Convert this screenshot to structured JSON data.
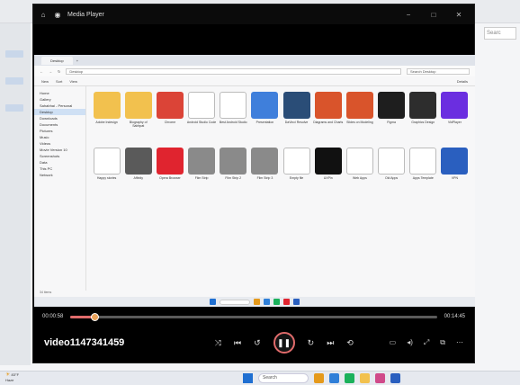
{
  "background_app": {
    "search_label": "Searc"
  },
  "player": {
    "title": "Media Player",
    "window_buttons": [
      "−",
      "□",
      "✕"
    ],
    "current_time": "00:00:58",
    "total_time": "00:14:45",
    "progress_fraction": 0.066,
    "video_name": "video1147341459",
    "accent_color": "#e06b6b"
  },
  "video_frame": {
    "tab_label": "Desktop",
    "address": "Desktop",
    "search_placeholder": "Search Desktop",
    "command_items": [
      "New",
      "Sort",
      "View",
      "Details"
    ],
    "nav_items": [
      "Home",
      "Gallery",
      "Sahabhai - Personal",
      "Desktop",
      "Downloads",
      "Documents",
      "Pictures",
      "Music",
      "Videos",
      "Movie Version 10",
      "Screenshots",
      "Data",
      "This PC",
      "Network"
    ],
    "status_text": "34 items",
    "files": [
      {
        "label": "Adobe Indesign",
        "color": "#f2c14e"
      },
      {
        "label": "Biography of Sabhpat",
        "color": "#f2c14e"
      },
      {
        "label": "Chrome",
        "color": "#db4437"
      },
      {
        "label": "Android Studio Code",
        "color": "#ffffff"
      },
      {
        "label": "Best Android Studio",
        "color": "#ffffff"
      },
      {
        "label": "Presentation",
        "color": "#3f7fdb"
      },
      {
        "label": "DaVinci Resolve",
        "color": "#2a4d77"
      },
      {
        "label": "Diagrams and Charts",
        "color": "#d9542b"
      },
      {
        "label": "Slides on Modeling",
        "color": "#d9542b"
      },
      {
        "label": "Figma",
        "color": "#1e1e1e"
      },
      {
        "label": "Graphics Design",
        "color": "#2d2d2d"
      },
      {
        "label": "VidPlayer",
        "color": "#6b2ee0"
      },
      {
        "label": "Happy stories",
        "color": "#ffffff"
      },
      {
        "label": "Affinity",
        "color": "#5a5a5a"
      },
      {
        "label": "Opera Browser",
        "color": "#e0242f"
      },
      {
        "label": "Film Strip",
        "color": "#8a8a8a"
      },
      {
        "label": "Film Strip 2",
        "color": "#8a8a8a"
      },
      {
        "label": "Film Strip 3",
        "color": "#8a8a8a"
      },
      {
        "label": "Empty file",
        "color": "#ffffff"
      },
      {
        "label": "UXPin",
        "color": "#111111"
      },
      {
        "label": "Web Apps",
        "color": "#ffffff"
      },
      {
        "label": "Old Apps",
        "color": "#ffffff"
      },
      {
        "label": "Apps Template",
        "color": "#ffffff"
      },
      {
        "label": "VPN",
        "color": "#2a5fbf"
      }
    ]
  },
  "taskbar": {
    "weather_temp": "83°F",
    "weather_desc": "Haze",
    "search_label": "Search"
  }
}
